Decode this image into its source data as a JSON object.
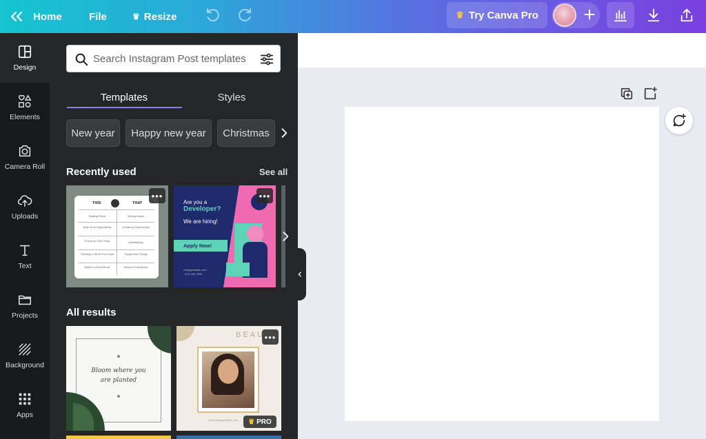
{
  "topbar": {
    "home": "Home",
    "file": "File",
    "resize": "Resize",
    "try_pro": "Try Canva Pro"
  },
  "rail": {
    "items": [
      {
        "label": "Design",
        "icon": "layout-icon",
        "active": true
      },
      {
        "label": "Elements",
        "icon": "shapes-icon"
      },
      {
        "label": "Camera Roll",
        "icon": "camera-icon"
      },
      {
        "label": "Uploads",
        "icon": "cloud-upload-icon"
      },
      {
        "label": "Text",
        "icon": "text-icon"
      },
      {
        "label": "Projects",
        "icon": "folder-icon"
      },
      {
        "label": "Background",
        "icon": "hatch-icon"
      },
      {
        "label": "Apps",
        "icon": "grid-icon"
      }
    ]
  },
  "panel": {
    "search_placeholder": "Search Instagram Post templates",
    "tabs": [
      "Templates",
      "Styles"
    ],
    "chips": [
      "New year",
      "Happy new year",
      "Christmas"
    ],
    "recently_used": "Recently used",
    "see_all": "See all",
    "all_results": "All results",
    "pro_badge": "PRO",
    "more": "•••"
  },
  "templates": {
    "this_that": {
      "left_header": "THIS",
      "right_header": "THAT",
      "rows": [
        [
          "Making Plans",
          "Seeing Action"
        ],
        [
          "Wait for an Opportunity",
          "Create an Opportunity"
        ],
        [
          "Focus on One Thing",
          "Multitasking"
        ],
        [
          "Sticking to What You Know",
          "Trying New Things"
        ],
        [
          "Watch a Good Movie",
          "Read a Good Book"
        ]
      ]
    },
    "developer": {
      "line1": "Are you a",
      "line2": "Developer?",
      "line3": "We are hiring!",
      "button": "Apply Now!",
      "footer1": "reallygreatsite.com",
      "footer2": "+123-456-7890"
    },
    "bloom": {
      "text": "Bloom where you are planted"
    },
    "beauty": {
      "heading": "BEAU",
      "url": "www.reallygreatsite.com"
    }
  },
  "colors": {
    "accent_underline": "#8b7df0",
    "rail_bg": "#18191b",
    "panel_bg": "#252627",
    "pro_crown": "#f7c744"
  }
}
